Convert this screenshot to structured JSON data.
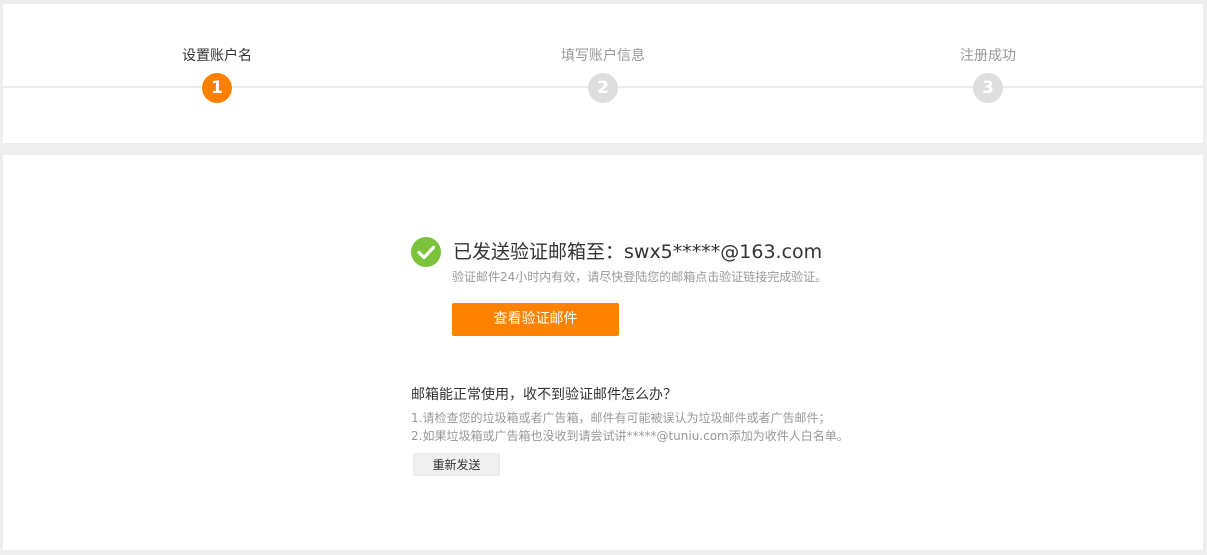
{
  "steps": [
    {
      "label": "设置账户名",
      "number": "1",
      "state": "active"
    },
    {
      "label": "填写账户信息",
      "number": "2",
      "state": "inactive"
    },
    {
      "label": "注册成功",
      "number": "3",
      "state": "inactive"
    }
  ],
  "verification": {
    "title": "已发送验证邮箱至：swx5*****@163.com",
    "subtitle": "验证邮件24小时内有效，请尽快登陆您的邮箱点击验证链接完成验证。",
    "view_button_label": "查看验证邮件",
    "success_icon": "check-circle-icon"
  },
  "help": {
    "title": "邮箱能正常使用，收不到验证邮件怎么办？",
    "items": [
      "1.请检查您的垃圾箱或者广告箱，邮件有可能被误认为垃圾邮件或者广告邮件；",
      "2.如果垃圾箱或广告箱也没收到请尝试讲*****@tuniu.com添加为收件人白名单。"
    ],
    "resend_button_label": "重新发送"
  },
  "colors": {
    "accent": "#ff8100",
    "success": "#7cc23a",
    "inactive_step": "#dedede",
    "background": "#eeeeee"
  }
}
